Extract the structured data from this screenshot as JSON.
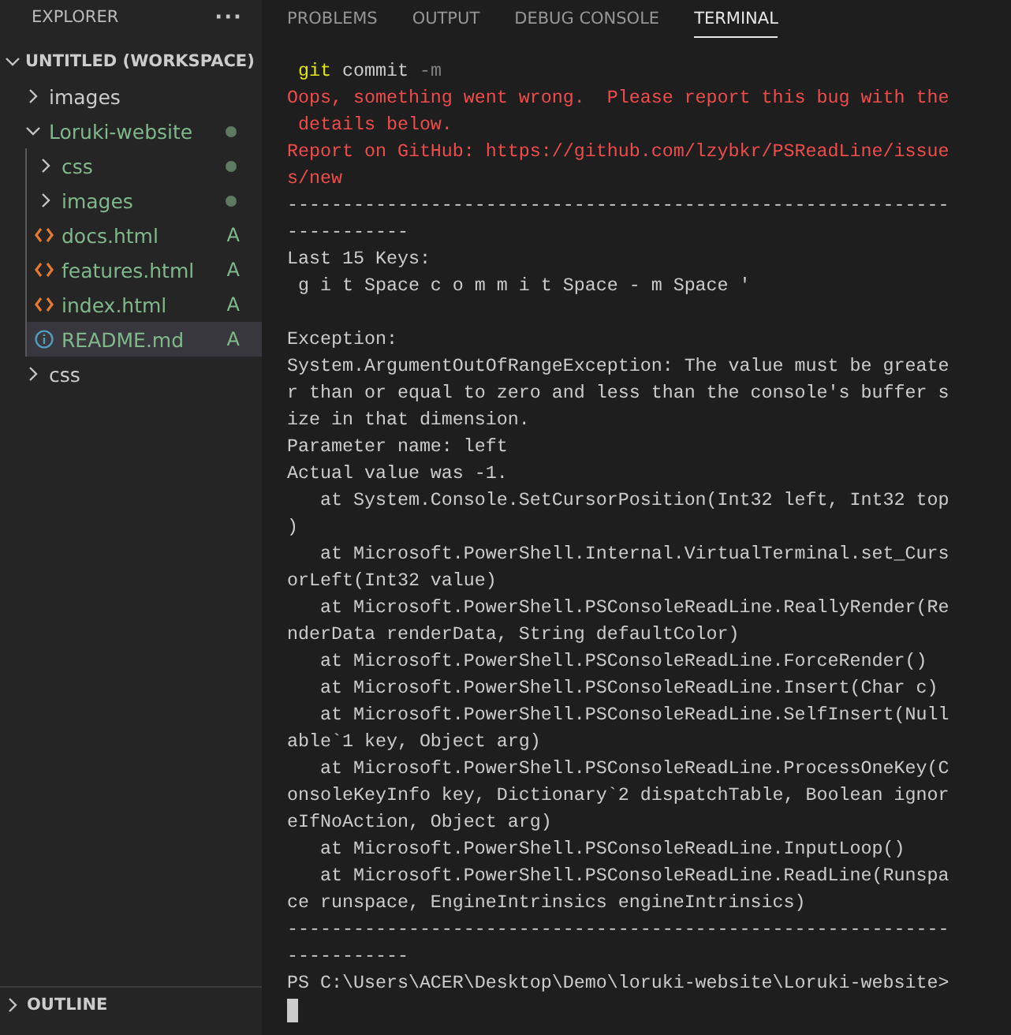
{
  "sidebar": {
    "title": "EXPLORER",
    "more": "···",
    "workspace": {
      "label": "UNTITLED (WORKSPACE)",
      "expanded": true
    },
    "tree": [
      {
        "label": "images",
        "kind": "folder",
        "expanded": false,
        "selected": false
      },
      {
        "label": "Loruki-website",
        "kind": "folder",
        "expanded": true,
        "selected": false,
        "has_changes": true,
        "children": [
          {
            "label": "css",
            "kind": "folder",
            "expanded": false,
            "selected": false,
            "has_changes": true
          },
          {
            "label": "images",
            "kind": "folder",
            "expanded": false,
            "selected": false,
            "has_changes": true
          },
          {
            "label": "docs.html",
            "kind": "html",
            "selected": false,
            "badge": "A"
          },
          {
            "label": "features.html",
            "kind": "html",
            "selected": false,
            "badge": "A"
          },
          {
            "label": "index.html",
            "kind": "html",
            "selected": false,
            "badge": "A"
          },
          {
            "label": "README.md",
            "kind": "info",
            "selected": true,
            "badge": "A"
          }
        ]
      },
      {
        "label": "css",
        "kind": "folder",
        "expanded": false,
        "selected": false
      }
    ],
    "outline": {
      "label": "OUTLINE",
      "expanded": false
    }
  },
  "panel": {
    "tabs": [
      {
        "label": "PROBLEMS",
        "selected": false
      },
      {
        "label": "OUTPUT",
        "selected": false
      },
      {
        "label": "DEBUG CONSOLE",
        "selected": false
      },
      {
        "label": "TERMINAL",
        "selected": true
      }
    ],
    "terminal": {
      "lines": [
        {
          "kind": "command",
          "program": "git",
          "args": "commit",
          "flag": "-m"
        },
        {
          "kind": "error",
          "text": "Oops, something went wrong.  Please report this bug with the"
        },
        {
          "kind": "error",
          "text": " details below."
        },
        {
          "kind": "error",
          "text": "Report on GitHub: https://github.com/lzybkr/PSReadLine/issue"
        },
        {
          "kind": "error",
          "text": "s/new"
        },
        {
          "kind": "output",
          "text": "------------------------------------------------------------"
        },
        {
          "kind": "output",
          "text": "-----------"
        },
        {
          "kind": "output",
          "text": "Last 15 Keys:"
        },
        {
          "kind": "output",
          "text": " g i t Space c o m m i t Space - m Space '"
        },
        {
          "kind": "blank"
        },
        {
          "kind": "output",
          "text": "Exception:"
        },
        {
          "kind": "output",
          "text": "System.ArgumentOutOfRangeException: The value must be greate"
        },
        {
          "kind": "output",
          "text": "r than or equal to zero and less than the console's buffer s"
        },
        {
          "kind": "output",
          "text": "ize in that dimension."
        },
        {
          "kind": "output",
          "text": "Parameter name: left"
        },
        {
          "kind": "output",
          "text": "Actual value was -1."
        },
        {
          "kind": "output",
          "text": "   at System.Console.SetCursorPosition(Int32 left, Int32 top"
        },
        {
          "kind": "output",
          "text": ")"
        },
        {
          "kind": "output",
          "text": "   at Microsoft.PowerShell.Internal.VirtualTerminal.set_Curs"
        },
        {
          "kind": "output",
          "text": "orLeft(Int32 value)"
        },
        {
          "kind": "output",
          "text": "   at Microsoft.PowerShell.PSConsoleReadLine.ReallyRender(Re"
        },
        {
          "kind": "output",
          "text": "nderData renderData, String defaultColor)"
        },
        {
          "kind": "output",
          "text": "   at Microsoft.PowerShell.PSConsoleReadLine.ForceRender()"
        },
        {
          "kind": "output",
          "text": "   at Microsoft.PowerShell.PSConsoleReadLine.Insert(Char c)"
        },
        {
          "kind": "output",
          "text": "   at Microsoft.PowerShell.PSConsoleReadLine.SelfInsert(Null"
        },
        {
          "kind": "output",
          "text": "able`1 key, Object arg)"
        },
        {
          "kind": "output",
          "text": "   at Microsoft.PowerShell.PSConsoleReadLine.ProcessOneKey(C"
        },
        {
          "kind": "output",
          "text": "onsoleKeyInfo key, Dictionary`2 dispatchTable, Boolean ignor"
        },
        {
          "kind": "output",
          "text": "eIfNoAction, Object arg)"
        },
        {
          "kind": "output",
          "text": "   at Microsoft.PowerShell.PSConsoleReadLine.InputLoop()"
        },
        {
          "kind": "output",
          "text": "   at Microsoft.PowerShell.PSConsoleReadLine.ReadLine(Runspa"
        },
        {
          "kind": "output",
          "text": "ce runspace, EngineIntrinsics engineIntrinsics)"
        },
        {
          "kind": "output",
          "text": "------------------------------------------------------------"
        },
        {
          "kind": "output",
          "text": "-----------"
        },
        {
          "kind": "output",
          "text": "PS C:\\Users\\ACER\\Desktop\\Demo\\loruki-website\\Loruki-website>"
        },
        {
          "kind": "cursor"
        }
      ]
    }
  }
}
